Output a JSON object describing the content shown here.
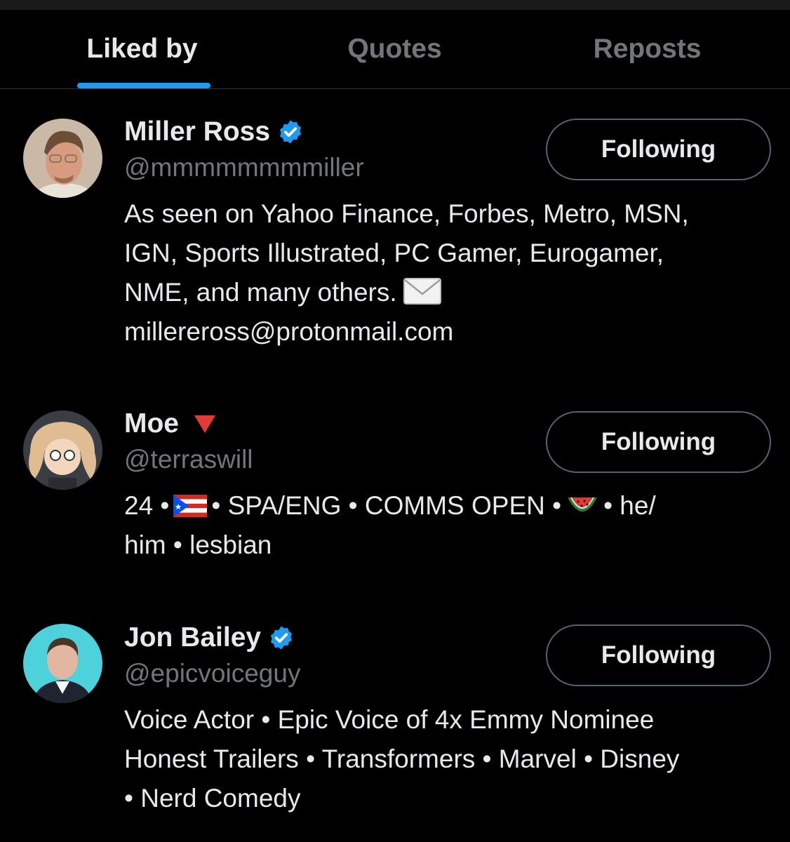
{
  "tabs": [
    {
      "label": "Liked by",
      "active": true
    },
    {
      "label": "Quotes",
      "active": false
    },
    {
      "label": "Reposts",
      "active": false
    }
  ],
  "colors": {
    "accent": "#1d9bf0",
    "muted": "#71767b",
    "text": "#e7e9ea",
    "background": "#000000"
  },
  "users": [
    {
      "name": "Miller Ross",
      "verified": true,
      "handle": "@mmmmmmmmiller",
      "button": "Following",
      "bio_lines": [
        "As seen on Yahoo Finance, Forbes, Metro, MSN,",
        "IGN, Sports Illustrated, PC Gamer, Eurogamer,",
        "NME, and many others.",
        "millereross@protonmail.com"
      ],
      "bio_icon": "envelope-icon"
    },
    {
      "name": "Moe",
      "verified": false,
      "name_badge": "red-triangle-icon",
      "handle": "@terraswill",
      "button": "Following",
      "bio_parts": {
        "p1": "24 •",
        "p2": "• SPA/ENG • COMMS OPEN •",
        "p3": "• he/",
        "p4": "him • lesbian"
      },
      "bio_icons": [
        "puerto-rico-flag-icon",
        "watermelon-icon"
      ]
    },
    {
      "name": "Jon Bailey",
      "verified": true,
      "handle": "@epicvoiceguy",
      "button": "Following",
      "bio_lines": [
        "Voice Actor • Epic Voice of 4x Emmy Nominee",
        "Honest Trailers • Transformers • Marvel • Disney",
        "• Nerd Comedy"
      ]
    }
  ]
}
